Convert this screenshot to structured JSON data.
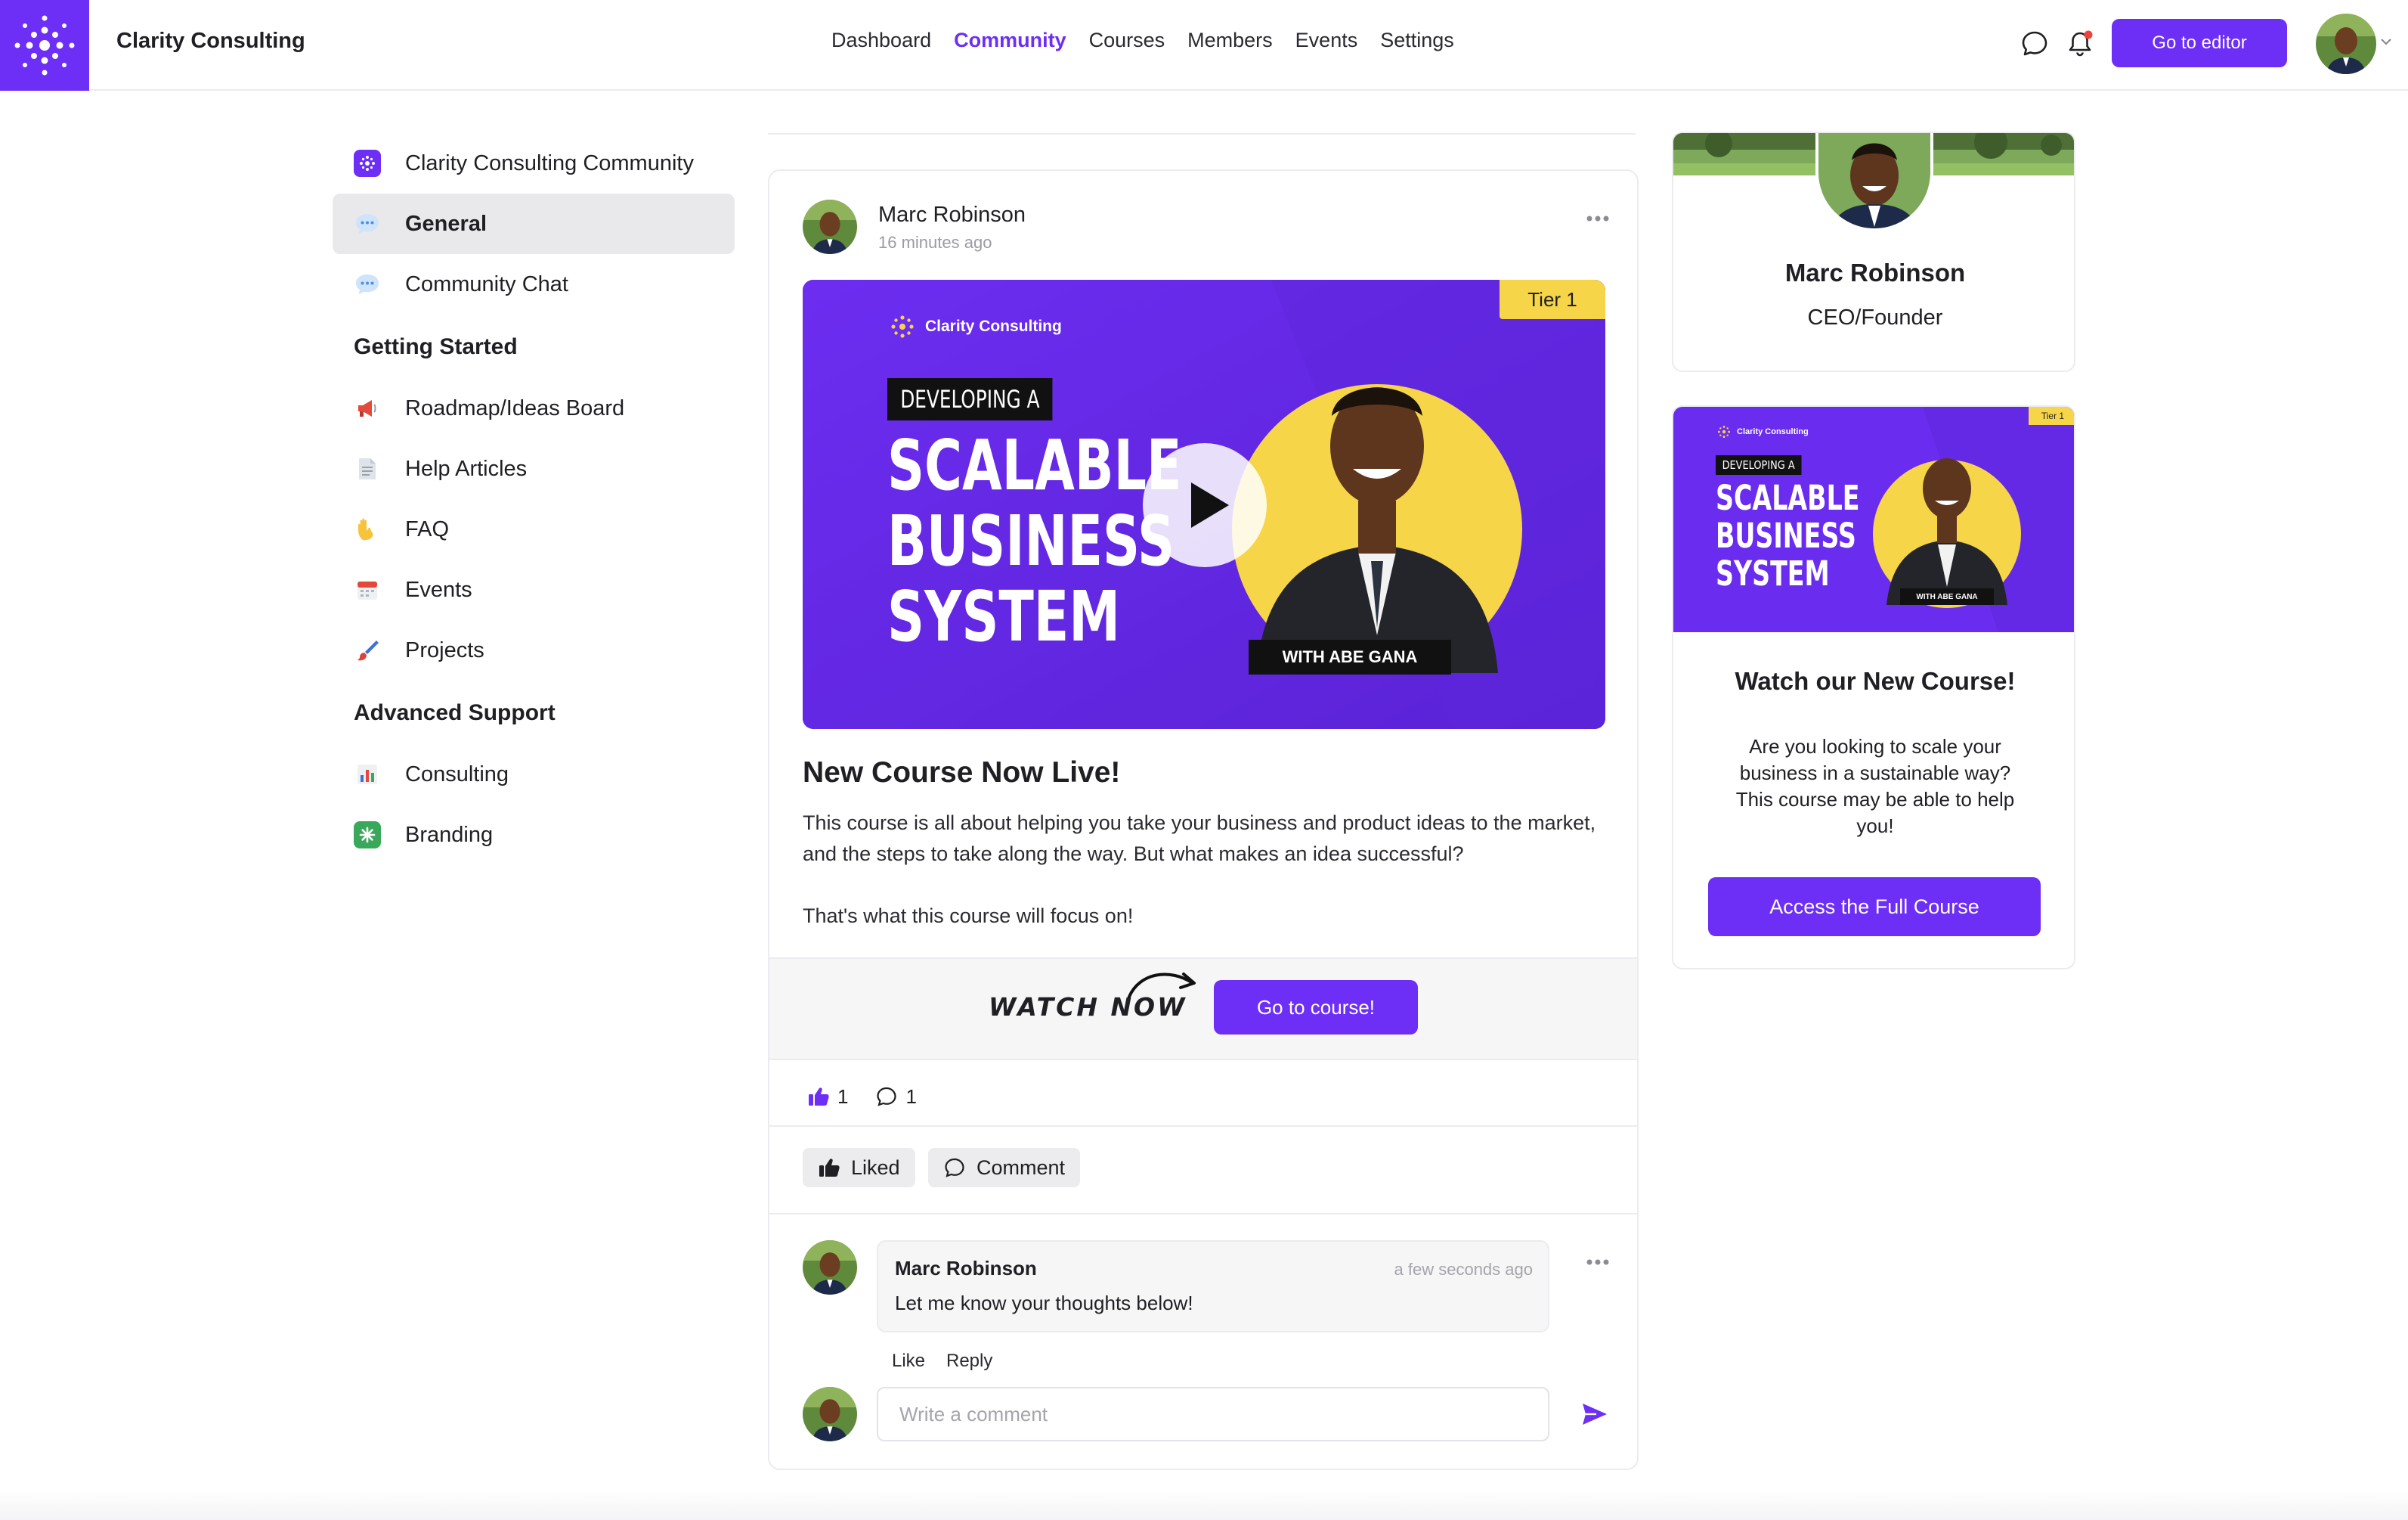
{
  "brand": {
    "name": "Clarity Consulting",
    "accent": "#6d2ef5"
  },
  "nav": {
    "items": [
      {
        "label": "Dashboard",
        "active": false
      },
      {
        "label": "Community",
        "active": true
      },
      {
        "label": "Courses",
        "active": false
      },
      {
        "label": "Members",
        "active": false
      },
      {
        "label": "Events",
        "active": false
      },
      {
        "label": "Settings",
        "active": false
      }
    ],
    "editor_button": "Go to editor",
    "icons": [
      "chat-bubble-icon",
      "bell-icon",
      "avatar",
      "chevron-down-icon"
    ]
  },
  "sidebar": {
    "top_items": [
      {
        "label": "Clarity Consulting Community",
        "icon": "community-logo-icon"
      },
      {
        "label": "General",
        "icon": "speech-bubble-icon",
        "active": true
      },
      {
        "label": "Community Chat",
        "icon": "speech-bubble-icon"
      }
    ],
    "sections": [
      {
        "heading": "Getting Started",
        "items": [
          {
            "label": "Roadmap/Ideas Board",
            "icon": "megaphone-icon"
          },
          {
            "label": "Help Articles",
            "icon": "document-icon"
          },
          {
            "label": "FAQ",
            "icon": "raised-hand-icon"
          },
          {
            "label": "Events",
            "icon": "calendar-icon"
          },
          {
            "label": "Projects",
            "icon": "paintbrush-icon"
          }
        ]
      },
      {
        "heading": "Advanced Support",
        "items": [
          {
            "label": "Consulting",
            "icon": "bar-chart-icon"
          },
          {
            "label": "Branding",
            "icon": "sparkle-icon"
          }
        ]
      }
    ]
  },
  "post": {
    "author": "Marc Robinson",
    "time": "16 minutes ago",
    "hero": {
      "brand": "Clarity Consulting",
      "tier": "Tier 1",
      "kicker": "DEVELOPING A",
      "headline_lines": [
        "SCALABLE",
        "BUSINESS",
        "SYSTEM"
      ],
      "presenter": "WITH ABE GANA"
    },
    "title": "New Course Now Live!",
    "body_1": "This course is all about helping you take your business and product ideas to the market, and the steps to take along the way. But what makes an idea successful?",
    "body_2": "That's what this course will focus on!",
    "watch_now": "WATCH NOW",
    "course_button": "Go to course!",
    "likes": "1",
    "comments": "1",
    "liked_button": "Liked",
    "comment_button": "Comment"
  },
  "comment": {
    "author": "Marc Robinson",
    "time": "a few seconds ago",
    "text": "Let me know your thoughts below!",
    "like": "Like",
    "reply": "Reply"
  },
  "comment_input": {
    "placeholder": "Write a comment"
  },
  "profile": {
    "name": "Marc Robinson",
    "role": "CEO/Founder"
  },
  "promo": {
    "title": "Watch our New Course!",
    "text": "Are you looking to scale your business in a sustainable way? This course may be able to help you!",
    "button": "Access the Full Course"
  }
}
